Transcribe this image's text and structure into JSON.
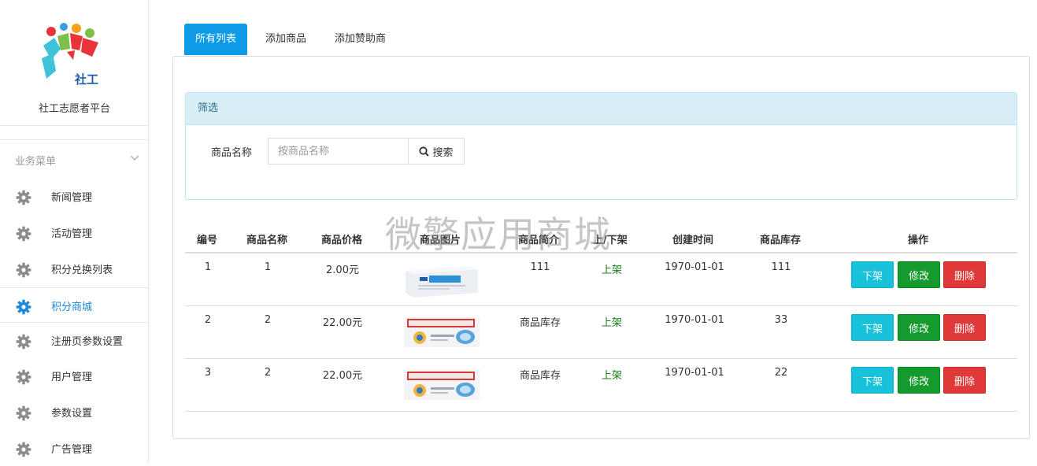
{
  "sidebar": {
    "site_name": "社工志愿者平台",
    "logo_text": "社工",
    "section_title": "业务菜单",
    "items": [
      {
        "label": "新闻管理",
        "icon": "gear-icon",
        "active": false
      },
      {
        "label": "活动管理",
        "icon": "gear-icon",
        "active": false
      },
      {
        "label": "积分兑换列表",
        "icon": "gear-icon",
        "active": false
      },
      {
        "label": "积分商城",
        "icon": "gear-icon",
        "active": true
      },
      {
        "label": "注册页参数设置",
        "icon": "gear-icon",
        "active": false
      },
      {
        "label": "用户管理",
        "icon": "gear-icon",
        "active": false
      },
      {
        "label": "参数设置",
        "icon": "gear-icon",
        "active": false
      },
      {
        "label": "广告管理",
        "icon": "gear-icon",
        "active": false
      }
    ]
  },
  "tabs": [
    {
      "label": "所有列表",
      "active": true
    },
    {
      "label": "添加商品",
      "active": false
    },
    {
      "label": "添加赞助商",
      "active": false
    }
  ],
  "filter": {
    "title": "筛选",
    "label": "商品名称",
    "placeholder": "按商品名称",
    "value": "",
    "search_label": "搜索"
  },
  "watermark": "微擎应用商城",
  "table": {
    "headers": [
      "编号",
      "商品名称",
      "商品价格",
      "商品图片",
      "商品简介",
      "上/下架",
      "创建时间",
      "商品库存",
      "操作"
    ],
    "rows": [
      {
        "id": "1",
        "name": "1",
        "price": "2.00元",
        "image": "medicine-box-blue",
        "intro": "111",
        "status": "上架",
        "created": "1970-01-01",
        "stock": "111"
      },
      {
        "id": "2",
        "name": "2",
        "price": "22.00元",
        "image": "medicine-box-red",
        "intro": "商品库存",
        "status": "上架",
        "created": "1970-01-01",
        "stock": "33"
      },
      {
        "id": "3",
        "name": "2",
        "price": "22.00元",
        "image": "medicine-box-red",
        "intro": "商品库存",
        "status": "上架",
        "created": "1970-01-01",
        "stock": "22"
      }
    ],
    "actions": {
      "off_shelf": "下架",
      "edit": "修改",
      "delete": "删除"
    }
  },
  "colors": {
    "primary": "#0d9be8",
    "info": "#17c2da",
    "success": "#159a2e",
    "danger": "#e0393a",
    "filter_head": "#d9edf7"
  }
}
